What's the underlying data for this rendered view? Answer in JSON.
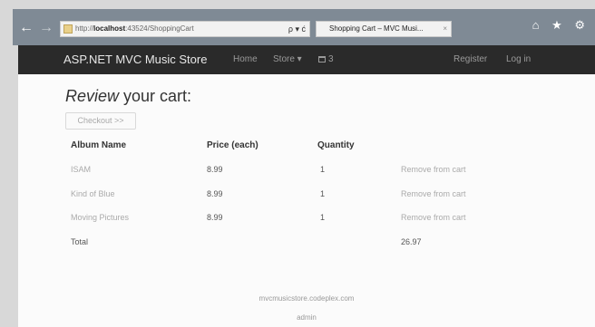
{
  "browser": {
    "back_icon": "back-arrow-icon",
    "forward_icon": "forward-arrow-icon",
    "address_prefix": "http://",
    "address_host": "localhost",
    "address_path": ":43524/ShoppingCart",
    "address_tools": "ρ ▾ ć",
    "tab_title": "Shopping Cart – MVC Musi...",
    "tab_close": "×",
    "window_tools": "⌂ ★ ⚙"
  },
  "navbar": {
    "brand": "ASP.NET MVC Music Store",
    "home": "Home",
    "store": "Store ▾",
    "cart_count": "3",
    "register": "Register",
    "login": "Log in"
  },
  "main": {
    "heading_em": "Review",
    "heading_rest": " your cart:",
    "checkout_button": "Checkout >>",
    "columns": {
      "album": "Album Name",
      "price": "Price (each)",
      "quantity": "Quantity"
    },
    "rows": [
      {
        "album": "ISAM",
        "price": "8.99",
        "quantity": "1",
        "remove": "Remove from cart"
      },
      {
        "album": "Kind of Blue",
        "price": "8.99",
        "quantity": "1",
        "remove": "Remove from cart"
      },
      {
        "album": "Moving Pictures",
        "price": "8.99",
        "quantity": "1",
        "remove": "Remove from cart"
      }
    ],
    "total_label": "Total",
    "total_value": "26.97"
  },
  "footer": {
    "site": "mvcmusicstore.codeplex.com",
    "admin": "admin"
  }
}
